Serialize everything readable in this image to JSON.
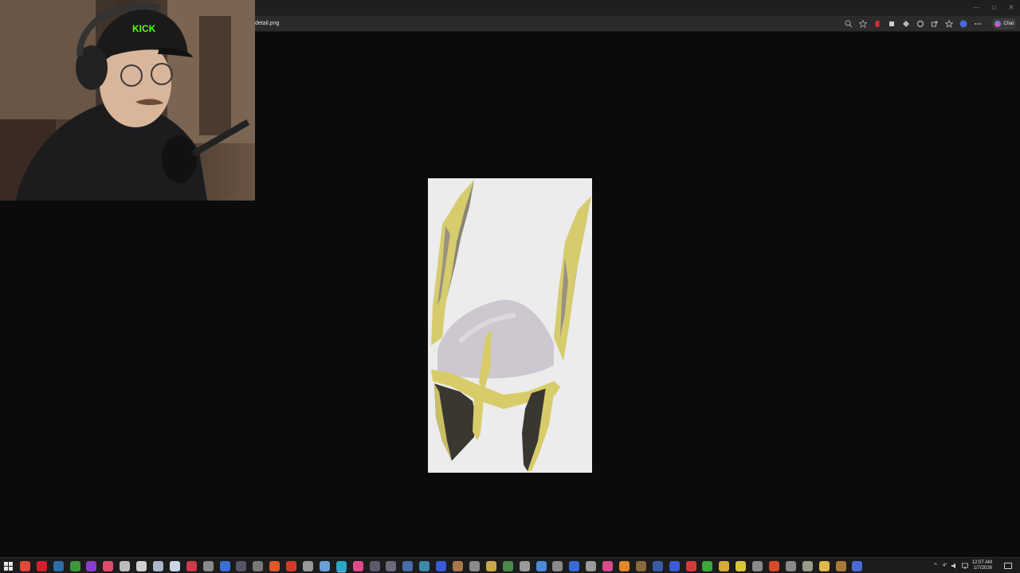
{
  "window": {
    "minimize_glyph": "—",
    "maximize_glyph": "▫",
    "close_glyph": "✕"
  },
  "address_bar": {
    "url_text": "detail.png",
    "chat_label": "Chat"
  },
  "colors": {
    "viewer_background": "#0b0b0b",
    "image_background": "#ececec",
    "helmet_gold": "#d8cc6a",
    "helmet_silver": "#cdc7cf"
  },
  "taskbar": {
    "apps": [
      {
        "name": "start",
        "color": "#e8e8e8",
        "glyph": "win"
      },
      {
        "name": "chrome",
        "color": "#e04a3a"
      },
      {
        "name": "opera",
        "color": "#d2202f"
      },
      {
        "name": "steam",
        "color": "#2a6fa8"
      },
      {
        "name": "xbox",
        "color": "#3a9a3a"
      },
      {
        "name": "app-purple",
        "color": "#8a3ccf"
      },
      {
        "name": "app-pink",
        "color": "#e04a6a"
      },
      {
        "name": "app-x",
        "color": "#bdbdbd"
      },
      {
        "name": "app-z",
        "color": "#d0d0d0"
      },
      {
        "name": "app-shield",
        "color": "#a8b8c8"
      },
      {
        "name": "file",
        "color": "#c9d6e6"
      },
      {
        "name": "app-red",
        "color": "#d13a4a"
      },
      {
        "name": "app-gray",
        "color": "#8a8a8a"
      },
      {
        "name": "app-blue",
        "color": "#3b6ed8"
      },
      {
        "name": "app-dark",
        "color": "#555566"
      },
      {
        "name": "app-dots",
        "color": "#7a7a7a"
      },
      {
        "name": "app-orange",
        "color": "#e0572a"
      },
      {
        "name": "app-bolt",
        "color": "#d43a2a"
      },
      {
        "name": "app-gear",
        "color": "#9a9a9a"
      },
      {
        "name": "app-c",
        "color": "#6aa0d8"
      },
      {
        "name": "edge",
        "color": "#2aa8c8",
        "active": true
      },
      {
        "name": "app-pink2",
        "color": "#e04a8a"
      },
      {
        "name": "app-gray2",
        "color": "#5a5a6a"
      },
      {
        "name": "app-star",
        "color": "#6a6a7a"
      },
      {
        "name": "app-r",
        "color": "#4a6aaa"
      },
      {
        "name": "app-teal",
        "color": "#3a8aa8"
      },
      {
        "name": "app-blue2",
        "color": "#3a5ad8"
      },
      {
        "name": "app-brown",
        "color": "#a8784a"
      },
      {
        "name": "app-cross",
        "color": "#8a8a8a"
      },
      {
        "name": "app-k",
        "color": "#c8a84a"
      },
      {
        "name": "app-green",
        "color": "#4a8a4a"
      },
      {
        "name": "app-home",
        "color": "#9a9a9a"
      },
      {
        "name": "app-link",
        "color": "#4a8ad8"
      },
      {
        "name": "app-x2",
        "color": "#8a8a8a"
      },
      {
        "name": "app-g",
        "color": "#3a6ad8"
      },
      {
        "name": "app-board",
        "color": "#9a9a9a"
      },
      {
        "name": "app-red2",
        "color": "#d84a8a"
      },
      {
        "name": "app-fox",
        "color": "#e0882a"
      },
      {
        "name": "app-down",
        "color": "#8a6a3a"
      },
      {
        "name": "app-cam",
        "color": "#3a5aa8"
      },
      {
        "name": "app-net",
        "color": "#3a5ad8"
      },
      {
        "name": "app-red3",
        "color": "#d83a3a"
      },
      {
        "name": "app-green2",
        "color": "#3aa83a"
      },
      {
        "name": "app-chrome2",
        "color": "#d8a83a"
      },
      {
        "name": "app-yellow",
        "color": "#d8c83a"
      },
      {
        "name": "app-bars",
        "color": "#8a8a8a"
      },
      {
        "name": "app-m",
        "color": "#d84a2a"
      },
      {
        "name": "app-search",
        "color": "#8a8a8a"
      },
      {
        "name": "app-anvil",
        "color": "#9a9a8a"
      },
      {
        "name": "folder",
        "color": "#e0b84a"
      },
      {
        "name": "app-brown2",
        "color": "#a87a3a"
      },
      {
        "name": "app-play",
        "color": "#4a6ad8"
      }
    ],
    "tray": {
      "chevron": "^",
      "temp": "4°",
      "time": "12:07 AM",
      "date": "1/7/2026"
    }
  }
}
